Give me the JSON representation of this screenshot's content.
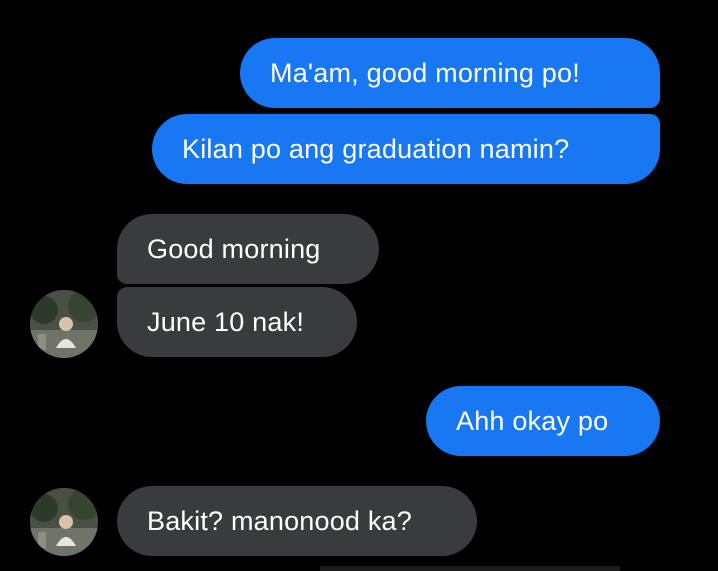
{
  "messages": [
    {
      "side": "sent",
      "text": "Ma'am, good morning po!"
    },
    {
      "side": "sent",
      "text": "Kilan po ang graduation namin?"
    },
    {
      "side": "received",
      "text": "Good morning"
    },
    {
      "side": "received",
      "text": "June 10 nak!"
    },
    {
      "side": "sent",
      "text": "Ahh okay po"
    },
    {
      "side": "received",
      "text": "Bakit? manonood ka?"
    }
  ],
  "colors": {
    "background": "#000000",
    "sent_bubble": "#1877f2",
    "received_bubble": "#3a3b3c",
    "text": "#ffffff"
  },
  "icons": {
    "contact_avatar": "contact-avatar-photo"
  }
}
